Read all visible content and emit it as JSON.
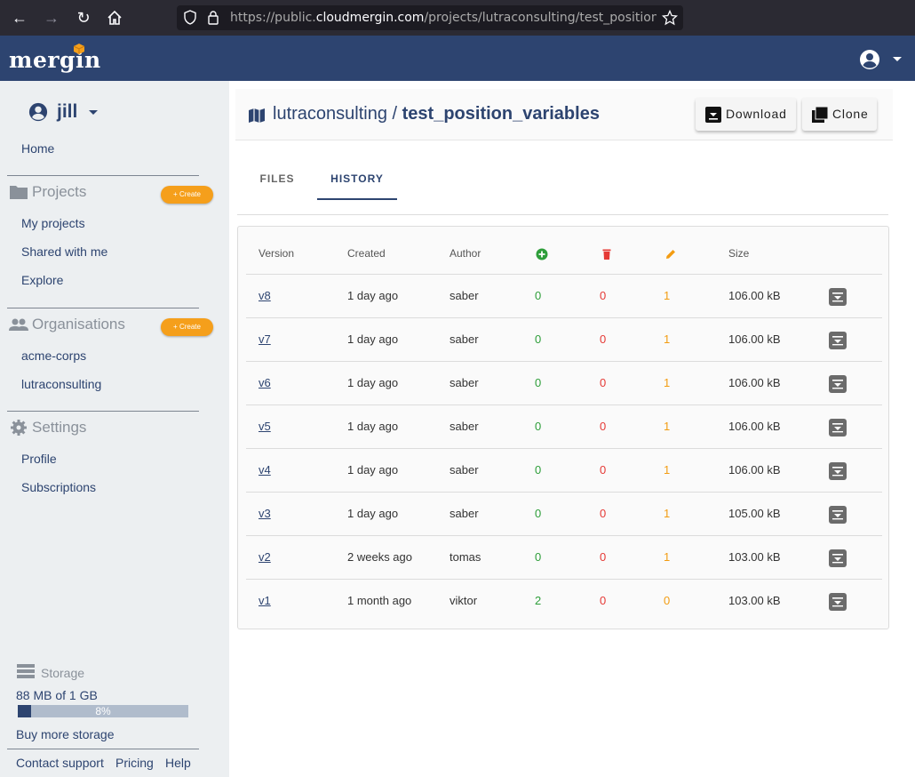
{
  "browser": {
    "url_prefix": "https://public.",
    "url_domain": "cloudmergin.com",
    "url_path": "/projects/lutraconsulting/test_position_va"
  },
  "header": {
    "logo": "mergin"
  },
  "sidebar": {
    "user": "jill",
    "home": "Home",
    "projects": {
      "title": "Projects",
      "create": "+ Create",
      "items": [
        "My projects",
        "Shared with me",
        "Explore"
      ]
    },
    "organisations": {
      "title": "Organisations",
      "create": "+ Create",
      "items": [
        "acme-corps",
        "lutraconsulting"
      ]
    },
    "settings": {
      "title": "Settings",
      "items": [
        "Profile",
        "Subscriptions"
      ]
    },
    "storage": {
      "label": "Storage",
      "amount": "88 MB of 1 GB",
      "percent_label": "8%",
      "percent": 8,
      "buy": "Buy more storage"
    },
    "footer": [
      "Contact support",
      "Pricing",
      "Help"
    ]
  },
  "project": {
    "namespace": "lutraconsulting",
    "separator": " / ",
    "name": "test_position_variables",
    "download": "Download",
    "clone": "Clone"
  },
  "tabs": [
    "FILES",
    "HISTORY"
  ],
  "history": {
    "columns": {
      "version": "Version",
      "created": "Created",
      "author": "Author",
      "added_icon": "plus-circle-icon",
      "removed_icon": "trash-icon",
      "updated_icon": "pencil-icon",
      "size": "Size"
    },
    "rows": [
      {
        "version": "v8",
        "created": "1 day ago",
        "author": "saber",
        "added": "0",
        "removed": "0",
        "updated": "1",
        "size": "106.00 kB"
      },
      {
        "version": "v7",
        "created": "1 day ago",
        "author": "saber",
        "added": "0",
        "removed": "0",
        "updated": "1",
        "size": "106.00 kB"
      },
      {
        "version": "v6",
        "created": "1 day ago",
        "author": "saber",
        "added": "0",
        "removed": "0",
        "updated": "1",
        "size": "106.00 kB"
      },
      {
        "version": "v5",
        "created": "1 day ago",
        "author": "saber",
        "added": "0",
        "removed": "0",
        "updated": "1",
        "size": "106.00 kB"
      },
      {
        "version": "v4",
        "created": "1 day ago",
        "author": "saber",
        "added": "0",
        "removed": "0",
        "updated": "1",
        "size": "106.00 kB"
      },
      {
        "version": "v3",
        "created": "1 day ago",
        "author": "saber",
        "added": "0",
        "removed": "0",
        "updated": "1",
        "size": "105.00 kB"
      },
      {
        "version": "v2",
        "created": "2 weeks ago",
        "author": "tomas",
        "added": "0",
        "removed": "0",
        "updated": "1",
        "size": "103.00 kB"
      },
      {
        "version": "v1",
        "created": "1 month ago",
        "author": "viktor",
        "added": "2",
        "removed": "0",
        "updated": "0",
        "size": "103.00 kB"
      }
    ]
  },
  "colors": {
    "brand": "#2d4470",
    "accent": "#f59f1b",
    "added": "#2e9e3a",
    "removed": "#e53935",
    "updated": "#f39c12"
  }
}
